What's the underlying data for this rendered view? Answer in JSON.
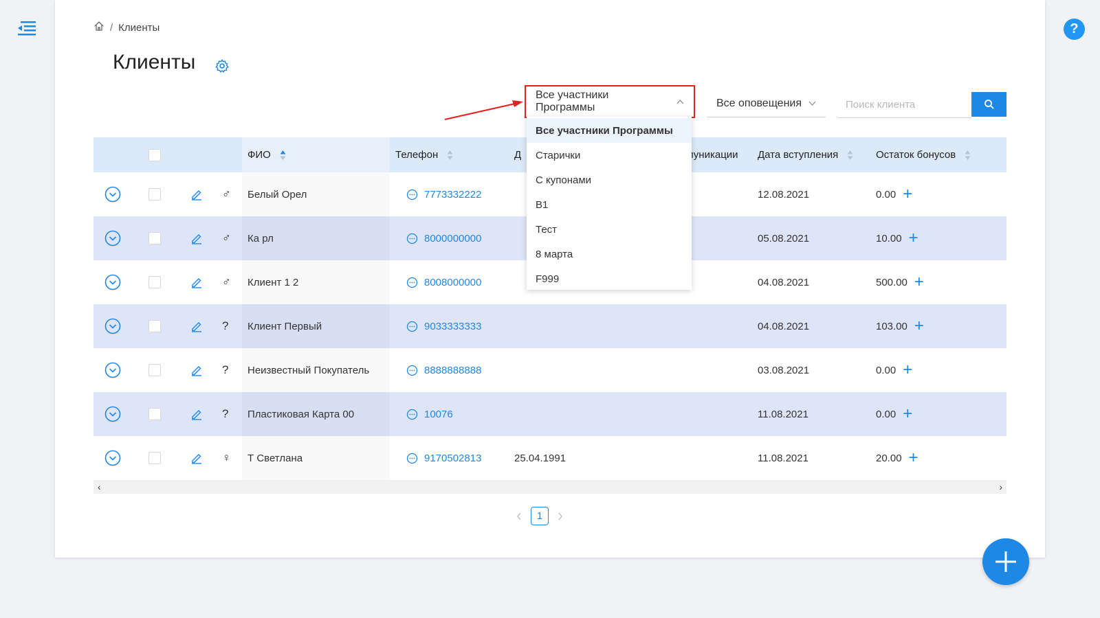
{
  "breadcrumb": {
    "current": "Клиенты",
    "separator": "/"
  },
  "page": {
    "title": "Клиенты"
  },
  "filters": {
    "program": {
      "selected": "Все участники Программы"
    },
    "notifications": {
      "selected": "Все оповещения"
    },
    "search": {
      "placeholder": "Поиск клиента",
      "value": ""
    }
  },
  "dropdown": {
    "options": [
      "Все участники Программы",
      "Старички",
      "С купонами",
      "B1",
      "Тест",
      "8 марта",
      "F999"
    ],
    "active_index": 0
  },
  "table": {
    "headers": {
      "fio": "ФИО",
      "phone": "Телефон",
      "hidden_partial": "Д",
      "communications": "ммуникации",
      "join_date": "Дата вступления",
      "bonus": "Остаток бонусов"
    },
    "rows": [
      {
        "gender": "♂",
        "name": "Белый Орел",
        "phone": "7773332222",
        "col4": "",
        "join_date": "12.08.2021",
        "bonus": "0.00"
      },
      {
        "gender": "♂",
        "name": "Ка рл",
        "phone": "8000000000",
        "col4": "",
        "join_date": "05.08.2021",
        "bonus": "10.00"
      },
      {
        "gender": "♂",
        "name": "Клиент 1 2",
        "phone": "8008000000",
        "col4": "",
        "join_date": "04.08.2021",
        "bonus": "500.00"
      },
      {
        "gender": "?",
        "name": "Клиент Первый",
        "phone": "9033333333",
        "col4": "",
        "join_date": "04.08.2021",
        "bonus": "103.00"
      },
      {
        "gender": "?",
        "name": "Неизвестный Покупатель",
        "phone": "8888888888",
        "col4": "",
        "join_date": "03.08.2021",
        "bonus": "0.00"
      },
      {
        "gender": "?",
        "name": "Пластиковая Карта 00",
        "phone": "10076",
        "col4": "",
        "join_date": "11.08.2021",
        "bonus": "0.00"
      },
      {
        "gender": "♀",
        "name": "Т Светлана",
        "phone": "9170502813",
        "col4": "25.04.1991",
        "join_date": "11.08.2021",
        "bonus": "20.00"
      }
    ]
  },
  "pagination": {
    "current_page": "1"
  },
  "icons": {
    "menu": "menu-collapse-icon",
    "help": "help-icon",
    "home": "home-icon",
    "gear": "gear-icon",
    "search": "search-icon",
    "expand": "chevron-down-circle-icon",
    "edit": "pencil-icon",
    "message": "message-bubble-icon",
    "plus": "plus-icon",
    "add": "add-fab-icon"
  },
  "colors": {
    "accent": "#1e88e5",
    "highlight_border": "#e61e1e",
    "row_alt": "#dee5f8",
    "header_bg": "#dbe9f8"
  },
  "help": {
    "label": "?"
  },
  "scroll": {
    "left": "‹",
    "right": "›"
  }
}
